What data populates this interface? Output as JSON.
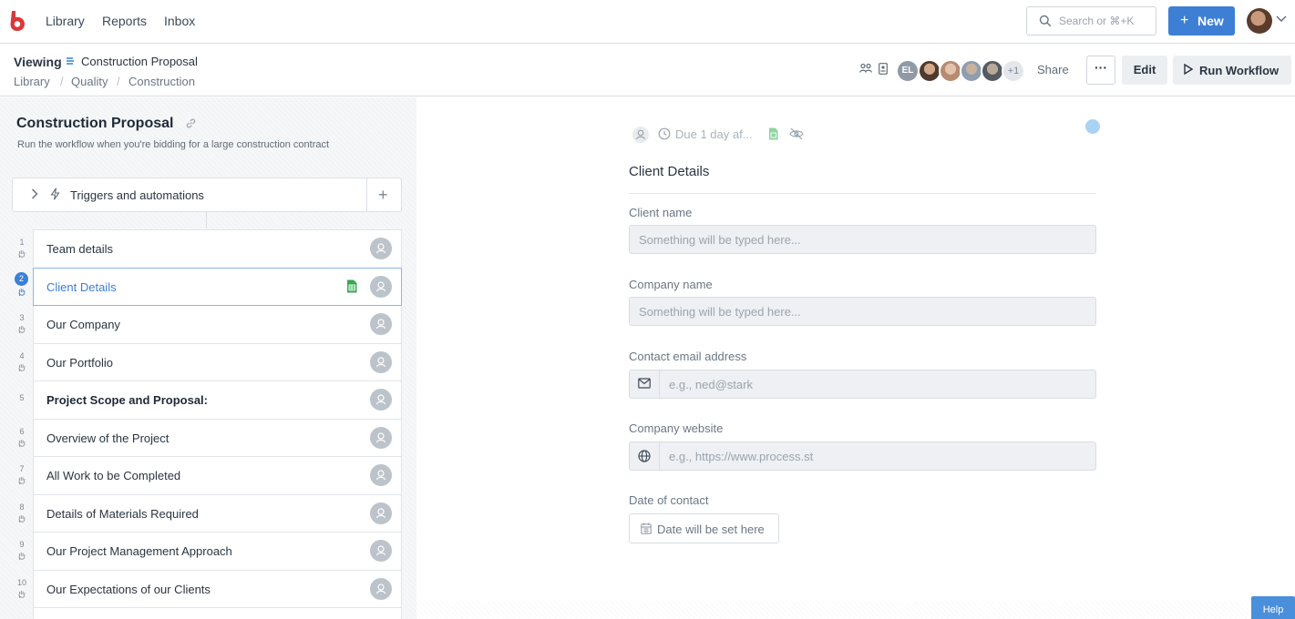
{
  "nav": {
    "links": [
      "Library",
      "Reports",
      "Inbox"
    ],
    "search_placeholder": "Search or ⌘+K",
    "new_label": "New"
  },
  "header": {
    "viewing_label": "Viewing",
    "doc_title": "Construction Proposal",
    "breadcrumbs": [
      "Library",
      "Quality",
      "Construction"
    ],
    "avatar_initials": "EL",
    "avatar_more": "+1",
    "share_label": "Share",
    "more_label": "···",
    "edit_label": "Edit",
    "run_label": "Run Workflow"
  },
  "workflow": {
    "title": "Construction Proposal",
    "description": "Run the workflow when you're bidding for a large construction contract",
    "triggers_label": "Triggers and automations",
    "tasks": [
      {
        "num": "1",
        "label": "Team details"
      },
      {
        "num": "2",
        "label": "Client Details"
      },
      {
        "num": "3",
        "label": "Our Company"
      },
      {
        "num": "4",
        "label": "Our Portfolio"
      },
      {
        "num": "5",
        "label": "Project Scope and Proposal:"
      },
      {
        "num": "6",
        "label": "Overview of the Project"
      },
      {
        "num": "7",
        "label": "All Work to be Completed"
      },
      {
        "num": "8",
        "label": "Details of Materials Required"
      },
      {
        "num": "9",
        "label": "Our Project Management Approach"
      },
      {
        "num": "10",
        "label": "Our Expectations of our Clients"
      }
    ]
  },
  "task": {
    "due_text": "Due 1 day af...",
    "heading": "Client Details",
    "fields": {
      "client_name": {
        "label": "Client name",
        "placeholder": "Something will be typed here..."
      },
      "company_name": {
        "label": "Company name",
        "placeholder": "Something will be typed here..."
      },
      "contact_email": {
        "label": "Contact email address",
        "placeholder": "e.g., ned@stark"
      },
      "company_website": {
        "label": "Company website",
        "placeholder": "e.g., https://www.process.st"
      },
      "date_of_contact": {
        "label": "Date of contact",
        "placeholder": "Date will be set here"
      }
    }
  },
  "help_label": "Help",
  "colors": {
    "accent": "#3d7fd4",
    "brand": "#d9383a"
  }
}
